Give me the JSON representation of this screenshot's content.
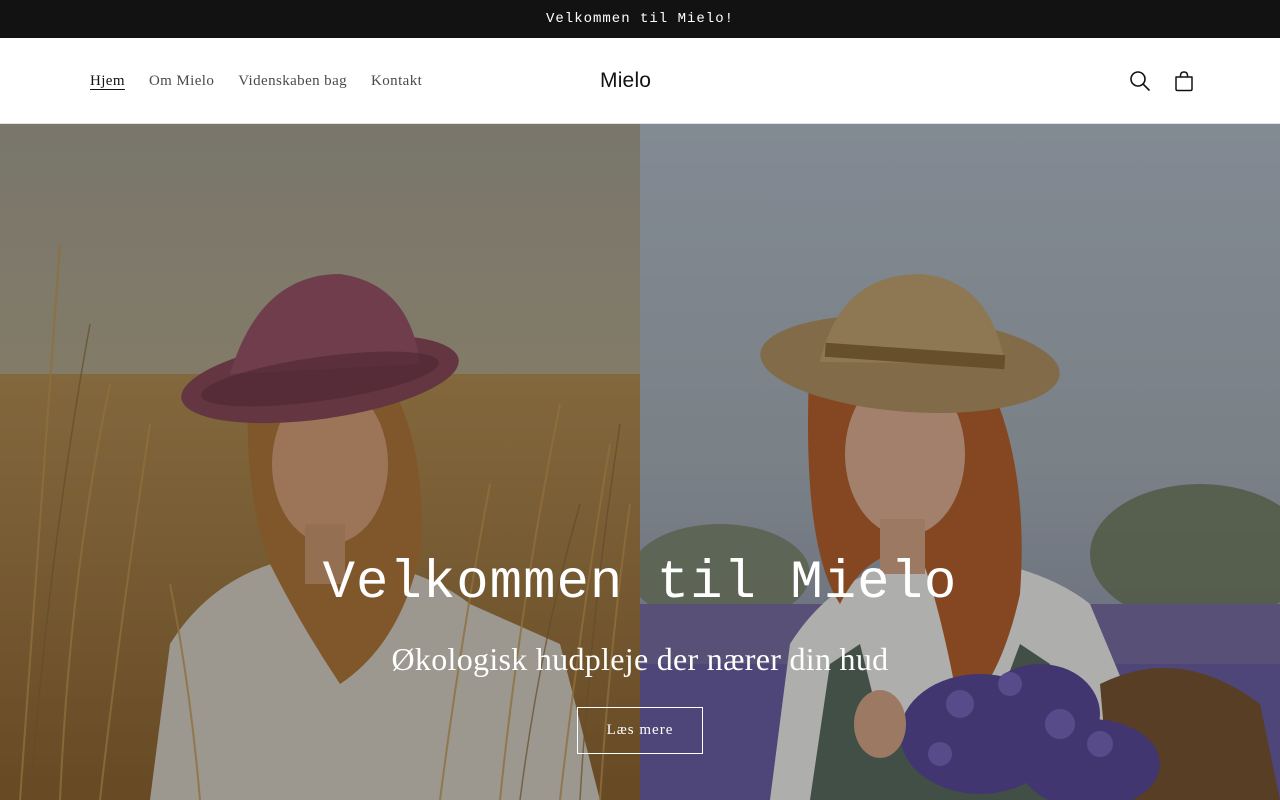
{
  "announcement": {
    "text": "Velkommen til Mielo!"
  },
  "header": {
    "nav": [
      {
        "label": "Hjem",
        "active": true
      },
      {
        "label": "Om Mielo",
        "active": false
      },
      {
        "label": "Videnskaben bag",
        "active": false
      },
      {
        "label": "Kontakt",
        "active": false
      }
    ],
    "logo": "Mielo",
    "icons": {
      "search": "search-icon",
      "cart": "cart-icon"
    }
  },
  "hero": {
    "title": "Velkommen til Mielo",
    "subtitle": "Økologisk hudpleje der nærer din hud",
    "button_label": "Læs mere"
  },
  "colors": {
    "announcement_bg": "#121212",
    "text": "#121212",
    "white": "#ffffff",
    "field_gold": "#b48a4a",
    "lavender": "#6a5ca8"
  }
}
